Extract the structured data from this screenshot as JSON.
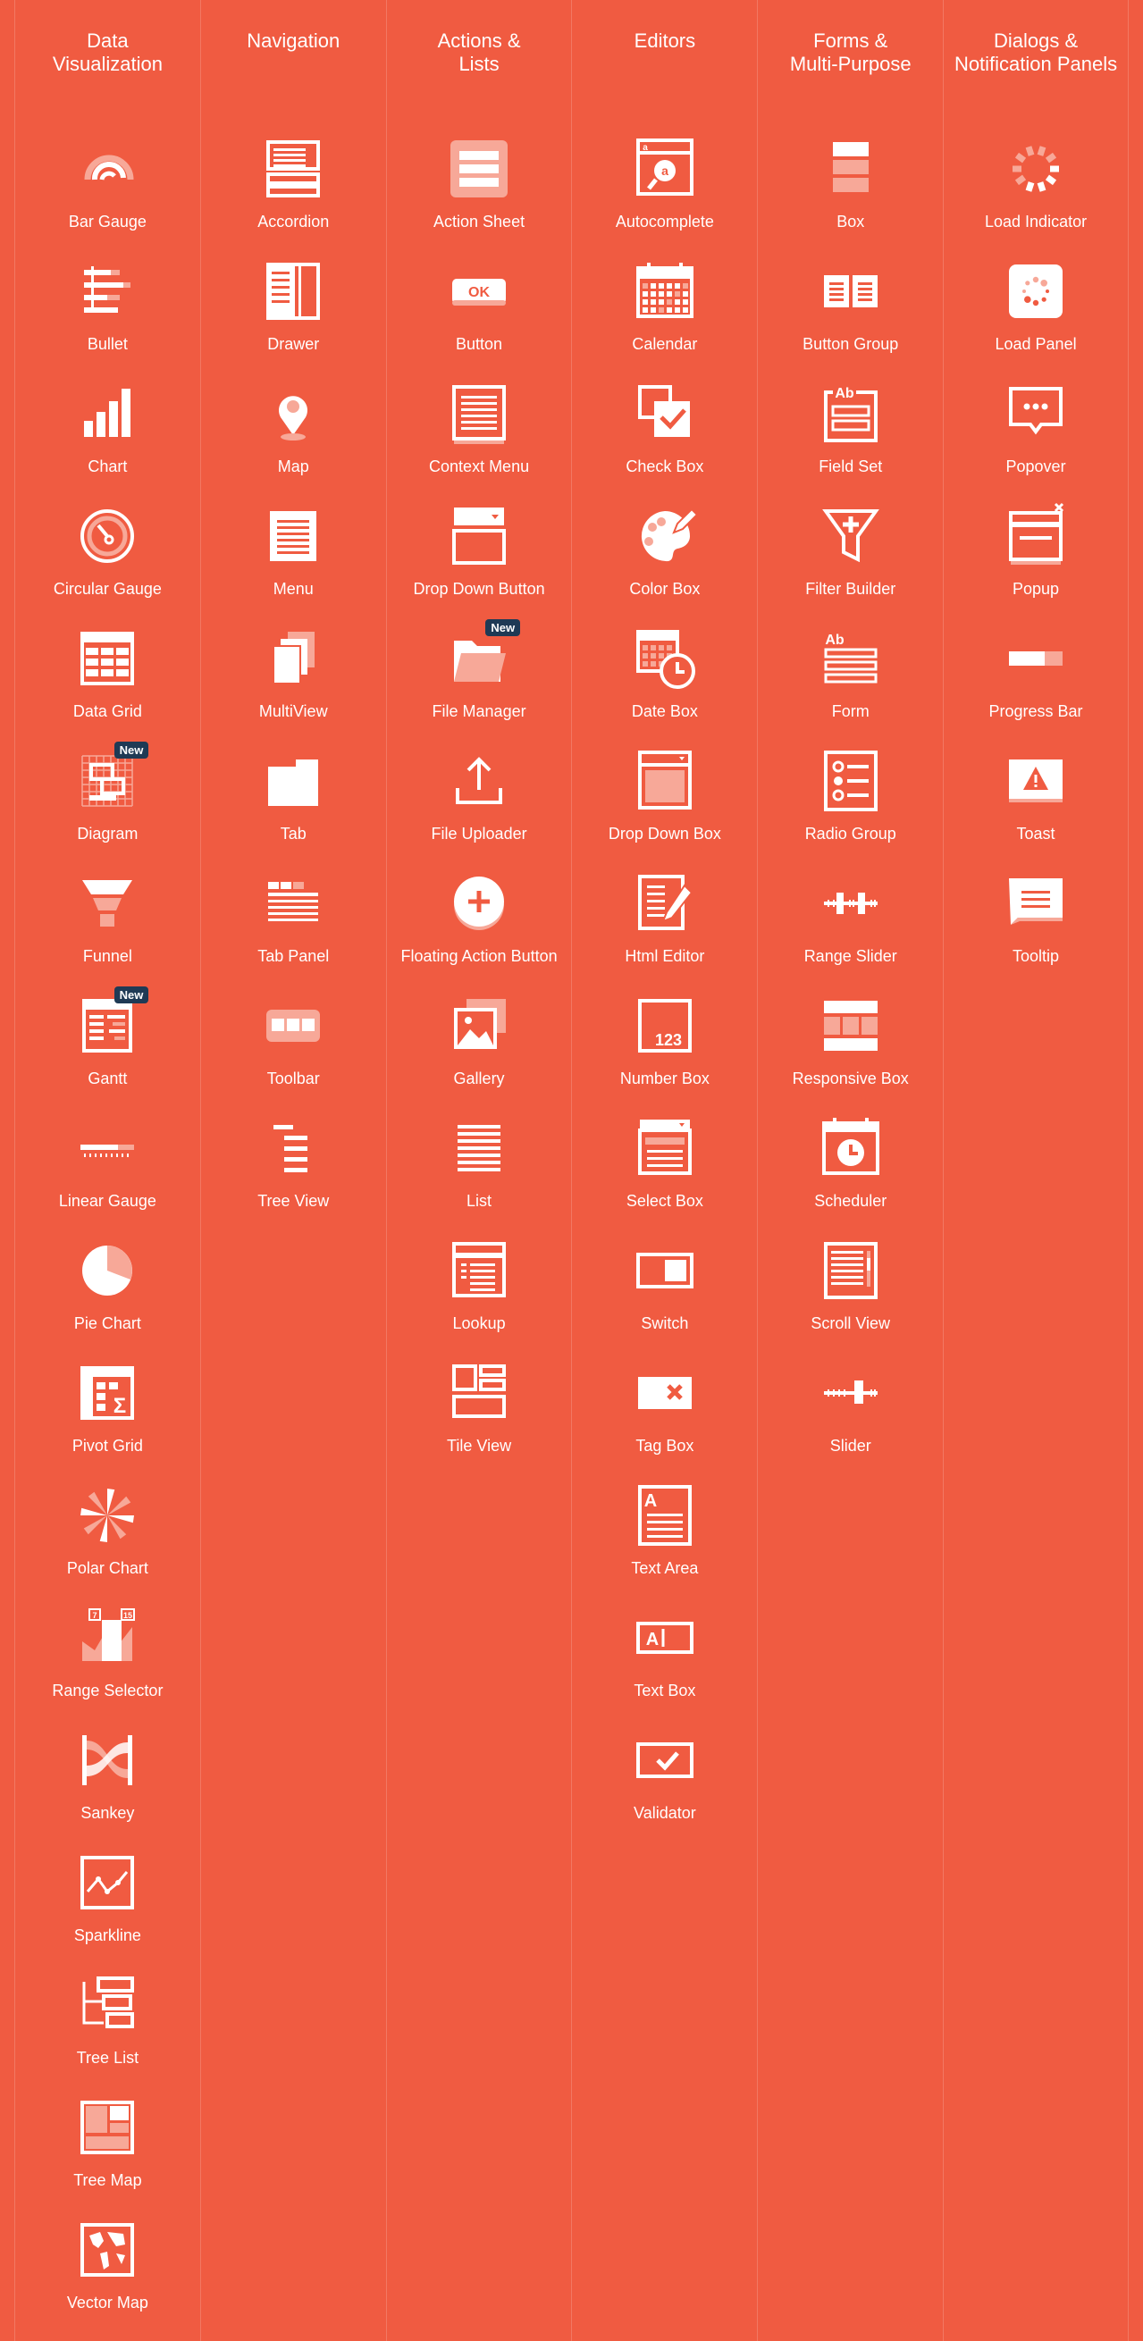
{
  "badge_label": "New",
  "colors": {
    "background": "#f05b41",
    "icon": "#ffffff",
    "icon_faded": "#f7a898",
    "badge": "#1f3a55"
  },
  "columns": [
    {
      "title": "Data\nVisualization",
      "items": [
        {
          "label": "Bar Gauge",
          "icon": "bar-gauge-icon",
          "new": false
        },
        {
          "label": "Bullet",
          "icon": "bullet-icon",
          "new": false
        },
        {
          "label": "Chart",
          "icon": "chart-icon",
          "new": false
        },
        {
          "label": "Circular Gauge",
          "icon": "circular-gauge-icon",
          "new": false
        },
        {
          "label": "Data Grid",
          "icon": "data-grid-icon",
          "new": false
        },
        {
          "label": "Diagram",
          "icon": "diagram-icon",
          "new": true
        },
        {
          "label": "Funnel",
          "icon": "funnel-icon",
          "new": false
        },
        {
          "label": "Gantt",
          "icon": "gantt-icon",
          "new": true
        },
        {
          "label": "Linear Gauge",
          "icon": "linear-gauge-icon",
          "new": false
        },
        {
          "label": "Pie Chart",
          "icon": "pie-chart-icon",
          "new": false
        },
        {
          "label": "Pivot Grid",
          "icon": "pivot-grid-icon",
          "new": false
        },
        {
          "label": "Polar Chart",
          "icon": "polar-chart-icon",
          "new": false
        },
        {
          "label": "Range Selector",
          "icon": "range-selector-icon",
          "new": false
        },
        {
          "label": "Sankey",
          "icon": "sankey-icon",
          "new": false
        },
        {
          "label": "Sparkline",
          "icon": "sparkline-icon",
          "new": false
        },
        {
          "label": "Tree List",
          "icon": "tree-list-icon",
          "new": false
        },
        {
          "label": "Tree Map",
          "icon": "tree-map-icon",
          "new": false
        },
        {
          "label": "Vector Map",
          "icon": "vector-map-icon",
          "new": false
        }
      ]
    },
    {
      "title": "Navigation",
      "items": [
        {
          "label": "Accordion",
          "icon": "accordion-icon",
          "new": false
        },
        {
          "label": "Drawer",
          "icon": "drawer-icon",
          "new": false
        },
        {
          "label": "Map",
          "icon": "map-icon",
          "new": false
        },
        {
          "label": "Menu",
          "icon": "menu-icon",
          "new": false
        },
        {
          "label": "MultiView",
          "icon": "multiview-icon",
          "new": false
        },
        {
          "label": "Tab",
          "icon": "tab-icon",
          "new": false
        },
        {
          "label": "Tab Panel",
          "icon": "tab-panel-icon",
          "new": false
        },
        {
          "label": "Toolbar",
          "icon": "toolbar-icon",
          "new": false
        },
        {
          "label": "Tree View",
          "icon": "tree-view-icon",
          "new": false
        }
      ]
    },
    {
      "title": "Actions &\nLists",
      "items": [
        {
          "label": "Action Sheet",
          "icon": "action-sheet-icon",
          "new": false
        },
        {
          "label": "Button",
          "icon": "button-icon",
          "new": false
        },
        {
          "label": "Context Menu",
          "icon": "context-menu-icon",
          "new": false
        },
        {
          "label": "Drop Down Button",
          "icon": "drop-down-button-icon",
          "new": false
        },
        {
          "label": "File Manager",
          "icon": "file-manager-icon",
          "new": true
        },
        {
          "label": "File Uploader",
          "icon": "file-uploader-icon",
          "new": false
        },
        {
          "label": "Floating Action Button",
          "icon": "floating-action-button-icon",
          "new": false
        },
        {
          "label": "Gallery",
          "icon": "gallery-icon",
          "new": false
        },
        {
          "label": "List",
          "icon": "list-icon",
          "new": false
        },
        {
          "label": "Lookup",
          "icon": "lookup-icon",
          "new": false
        },
        {
          "label": "Tile View",
          "icon": "tile-view-icon",
          "new": false
        }
      ]
    },
    {
      "title": "Editors",
      "items": [
        {
          "label": "Autocomplete",
          "icon": "autocomplete-icon",
          "new": false
        },
        {
          "label": "Calendar",
          "icon": "calendar-icon",
          "new": false
        },
        {
          "label": "Check Box",
          "icon": "check-box-icon",
          "new": false
        },
        {
          "label": "Color Box",
          "icon": "color-box-icon",
          "new": false
        },
        {
          "label": "Date Box",
          "icon": "date-box-icon",
          "new": false
        },
        {
          "label": "Drop Down Box",
          "icon": "drop-down-box-icon",
          "new": false
        },
        {
          "label": "Html Editor",
          "icon": "html-editor-icon",
          "new": false
        },
        {
          "label": "Number Box",
          "icon": "number-box-icon",
          "new": false
        },
        {
          "label": "Select Box",
          "icon": "select-box-icon",
          "new": false
        },
        {
          "label": "Switch",
          "icon": "switch-icon",
          "new": false
        },
        {
          "label": "Tag Box",
          "icon": "tag-box-icon",
          "new": false
        },
        {
          "label": "Text Area",
          "icon": "text-area-icon",
          "new": false
        },
        {
          "label": "Text Box",
          "icon": "text-box-icon",
          "new": false
        },
        {
          "label": "Validator",
          "icon": "validator-icon",
          "new": false
        }
      ]
    },
    {
      "title": "Forms &\nMulti-Purpose",
      "items": [
        {
          "label": "Box",
          "icon": "box-icon",
          "new": false
        },
        {
          "label": "Button Group",
          "icon": "button-group-icon",
          "new": false
        },
        {
          "label": "Field Set",
          "icon": "field-set-icon",
          "new": false
        },
        {
          "label": "Filter Builder",
          "icon": "filter-builder-icon",
          "new": false
        },
        {
          "label": "Form",
          "icon": "form-icon",
          "new": false
        },
        {
          "label": "Radio Group",
          "icon": "radio-group-icon",
          "new": false
        },
        {
          "label": "Range Slider",
          "icon": "range-slider-icon",
          "new": false
        },
        {
          "label": "Responsive Box",
          "icon": "responsive-box-icon",
          "new": false
        },
        {
          "label": "Scheduler",
          "icon": "scheduler-icon",
          "new": false
        },
        {
          "label": "Scroll View",
          "icon": "scroll-view-icon",
          "new": false
        },
        {
          "label": "Slider",
          "icon": "slider-icon",
          "new": false
        }
      ]
    },
    {
      "title": "Dialogs &\nNotification Panels",
      "items": [
        {
          "label": "Load Indicator",
          "icon": "load-indicator-icon",
          "new": false
        },
        {
          "label": "Load Panel",
          "icon": "load-panel-icon",
          "new": false
        },
        {
          "label": "Popover",
          "icon": "popover-icon",
          "new": false
        },
        {
          "label": "Popup",
          "icon": "popup-icon",
          "new": false
        },
        {
          "label": "Progress Bar",
          "icon": "progress-bar-icon",
          "new": false
        },
        {
          "label": "Toast",
          "icon": "toast-icon",
          "new": false
        },
        {
          "label": "Tooltip",
          "icon": "tooltip-icon",
          "new": false
        }
      ]
    }
  ],
  "icon_text": {
    "button": "OK",
    "autocomplete": "a",
    "field_set": "Ab",
    "form": "Ab",
    "number_box": "123",
    "text_area": "A",
    "text_box": "A",
    "pivot_grid": "Σ",
    "range_selector_left": "7",
    "range_selector_right": "15"
  }
}
